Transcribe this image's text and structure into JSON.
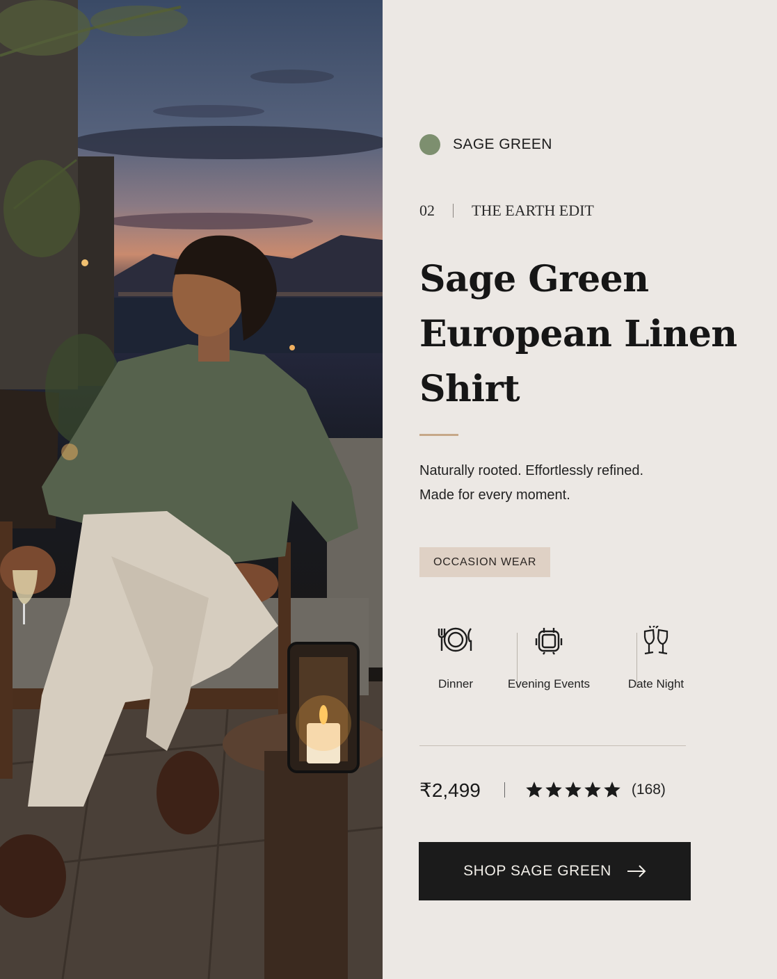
{
  "colors": {
    "swatch": "#7d8f6f",
    "accent_rule": "#c6a888",
    "tag_bg": "#dfd1c5",
    "cta_bg": "#1b1b1b",
    "panel_bg": "#ece8e4"
  },
  "hero_image": {
    "icon": "lifestyle-photo"
  },
  "color_swatch": {
    "label": "SAGE GREEN"
  },
  "collection": {
    "number": "02",
    "name": "THE EARTH EDIT"
  },
  "product": {
    "title_line1": "Sage Green",
    "title_line2": "European Linen",
    "title_line3": "Shirt",
    "tagline_line1": "Naturally rooted. Effortlessly refined.",
    "tagline_line2": "Made for every moment."
  },
  "tag": {
    "label": "OCCASION WEAR"
  },
  "occasions": [
    {
      "label": "Dinner",
      "icon": "plate-cutlery-icon"
    },
    {
      "label": "Evening Events",
      "icon": "event-icon"
    },
    {
      "label": "Date Night",
      "icon": "champagne-glasses-icon"
    }
  ],
  "pricing": {
    "price": "₹2,499",
    "rating": 5,
    "review_count": "(168)"
  },
  "cta": {
    "label": "SHOP SAGE GREEN",
    "icon": "arrow-right-icon"
  }
}
